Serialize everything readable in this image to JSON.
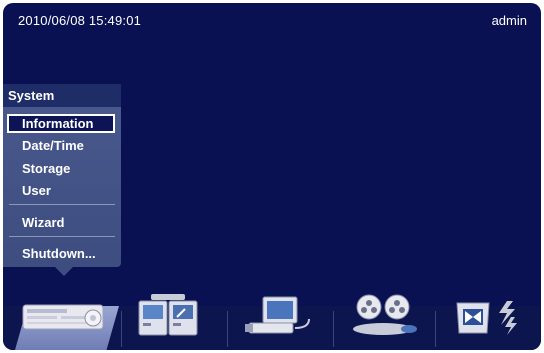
{
  "status": {
    "datetime": "2010/06/08  15:49:01",
    "user": "admin"
  },
  "menu": {
    "title": "System",
    "items": [
      {
        "label": "Information",
        "selected": true
      },
      {
        "label": "Date/Time"
      },
      {
        "label": "Storage"
      },
      {
        "label": "User"
      },
      {
        "label": "Wizard"
      },
      {
        "label": "Shutdown..."
      }
    ]
  },
  "toolbar": {
    "icons": [
      "dvr-system-icon",
      "monitor-layout-icon",
      "camera-device-icon",
      "film-reel-record-icon",
      "network-event-icon"
    ]
  },
  "colors": {
    "background": "#0a1152",
    "menu_panel": "#4a5a8e",
    "menu_title": "#1e2c68",
    "text": "#ffffff"
  }
}
